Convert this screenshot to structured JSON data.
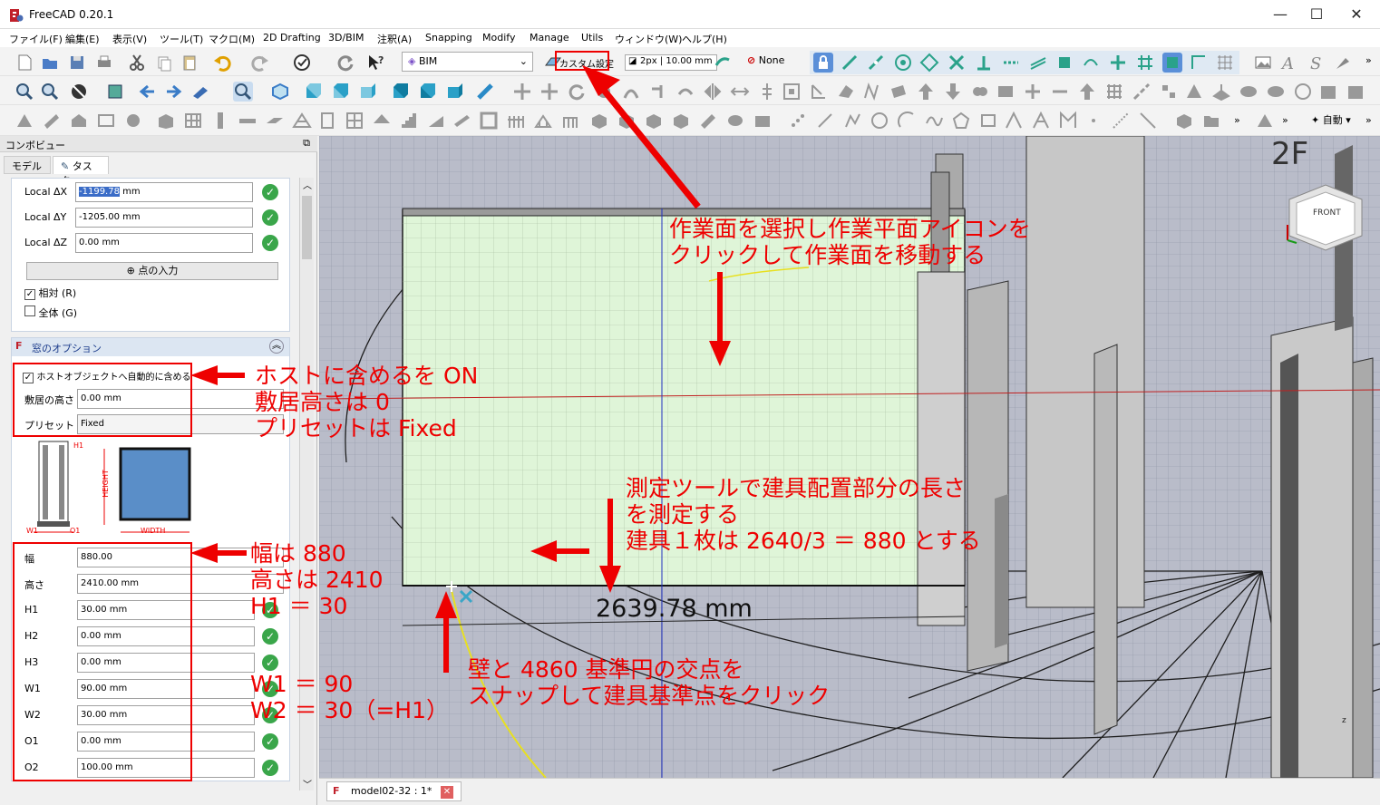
{
  "window": {
    "title": "FreeCAD 0.20.1",
    "minimize": "—",
    "maximize": "☐",
    "close": "✕"
  },
  "menu": [
    "ファイル(F)",
    "編集(E)",
    "表示(V)",
    "ツール(T)",
    "マクロ(M)",
    "2D Drafting",
    "3D/BIM",
    "注釈(A)",
    "Snapping",
    "Modify",
    "Manage",
    "Utils",
    "ウィンドウ(W)",
    "ヘルプ(H)"
  ],
  "toolbar": {
    "workbench": "BIM",
    "custom_setting": "カスタム設定",
    "line_width": "2px | 10.00 mm",
    "none_label": "None",
    "auto_label": "自動"
  },
  "panel": {
    "header": "コンボビュー",
    "tabs": [
      "モデル",
      "タスク"
    ],
    "coords": [
      {
        "label": "Local ΔX",
        "value": "-1199.78",
        "unit": "mm"
      },
      {
        "label": "Local ΔY",
        "value": "-1205.00 mm",
        "unit": ""
      },
      {
        "label": "Local ΔZ",
        "value": "0.00 mm",
        "unit": ""
      }
    ],
    "enter_point": "点の入力",
    "relative": "相対 (R)",
    "global": "全体 (G)",
    "window_options_title": "窓のオプション",
    "auto_include": "ホストオブジェクトへ自動的に含める",
    "sill_label": "敷居の高さ",
    "sill_value": "0.00 mm",
    "preset_label": "プリセット",
    "preset_value": "Fixed",
    "diagram": {
      "h1": "H1",
      "height": "HEIGHT",
      "w1": "W1",
      "o1": "O1",
      "width": "WIDTH"
    },
    "params": [
      {
        "label": "幅",
        "value": "880.00",
        "check": false
      },
      {
        "label": "高さ",
        "value": "2410.00 mm",
        "check": false
      },
      {
        "label": "H1",
        "value": "30.00 mm",
        "check": true
      },
      {
        "label": "H2",
        "value": "0.00 mm",
        "check": true
      },
      {
        "label": "H3",
        "value": "0.00 mm",
        "check": true
      },
      {
        "label": "W1",
        "value": "90.00 mm",
        "check": true
      },
      {
        "label": "W2",
        "value": "30.00 mm",
        "check": true
      },
      {
        "label": "O1",
        "value": "0.00 mm",
        "check": true
      },
      {
        "label": "O2",
        "value": "100.00 mm",
        "check": true
      }
    ]
  },
  "viewport": {
    "dimension": "2639.78 mm",
    "navcube_face": "FRONT",
    "navcube_label": "2F",
    "axis_z": "z"
  },
  "statusbar": {
    "doc_tab": "model02-32 : 1*"
  },
  "annotations": {
    "a1": "作業面を選択し作業平面アイコンを\nクリックして作業面を移動する",
    "a2": "ホストに含めるを ON\n敷居高さは 0\nプリセットは Fixed",
    "a3": "測定ツールで建具配置部分の長さ\nを測定する\n建具１枚は 2640/3 ＝ 880 とする",
    "a4": "幅は 880\n高さは 2410\nH1 ＝ 30",
    "a5": "W1 ＝ 90\nW2 ＝ 30（=H1）",
    "a6": "壁と 4860 基準円の交点を\nスナップして建具基準点をクリック"
  },
  "colors": {
    "annotation": "#ee0000",
    "viewport_bg": "#b9bcc9",
    "wall_face": "#dff5d8",
    "check": "#3aa64a"
  }
}
